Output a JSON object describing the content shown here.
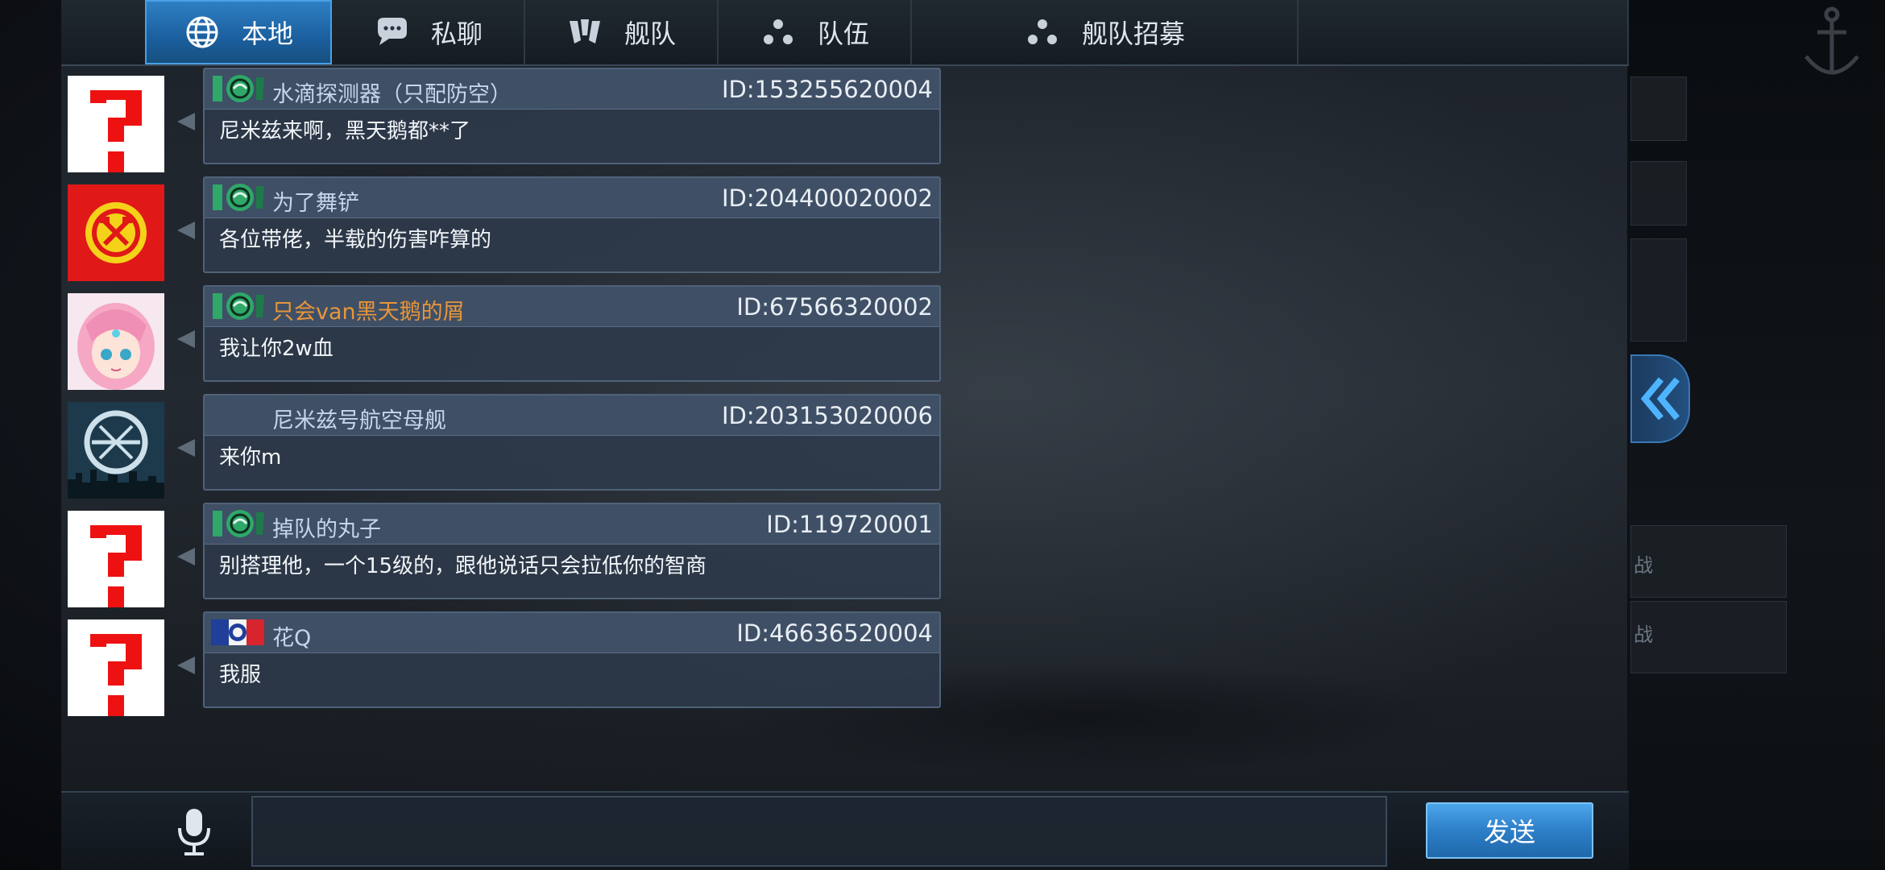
{
  "tabs": [
    {
      "label": "本地",
      "icon": "globe-icon",
      "active": true
    },
    {
      "label": "私聊",
      "icon": "chat-bubble-icon",
      "active": false
    },
    {
      "label": "舰队",
      "icon": "fleet-emblem-icon",
      "active": false
    },
    {
      "label": "队伍",
      "icon": "team-dots-icon",
      "active": false
    },
    {
      "label": "舰队招募",
      "icon": "team-dots-icon",
      "active": false
    }
  ],
  "messages": [
    {
      "sender": "水滴探测器（只配防空）",
      "user_id": "ID:153255620004",
      "text": "尼米兹来啊，黑天鹅都**了",
      "avatar": "placeholder-question",
      "badge": "green-swirl",
      "highlight": false
    },
    {
      "sender": "为了舞铲",
      "user_id": "ID:204400020002",
      "text": "各位带佬，半载的伤害咋算的",
      "avatar": "red-yellow-emblem",
      "badge": "green-swirl",
      "highlight": false
    },
    {
      "sender": "只会van黑天鹅的屑",
      "user_id": "ID:67566320002",
      "text": "我让你2w血",
      "avatar": "anime-girl",
      "badge": "green-swirl",
      "highlight": true
    },
    {
      "sender": "尼米兹号航空母舰",
      "user_id": "ID:203153020006",
      "text": "来你m",
      "avatar": "dark-crosshair",
      "badge": "none",
      "highlight": false
    },
    {
      "sender": "掉队的丸子",
      "user_id": "ID:119720001",
      "text": "别搭理他，一个15级的，跟他说话只会拉低你的智商",
      "avatar": "placeholder-question",
      "badge": "green-swirl",
      "highlight": false
    },
    {
      "sender": "花Q",
      "user_id": "ID:46636520004",
      "text": "我服",
      "avatar": "placeholder-question",
      "badge": "french-flag",
      "highlight": false
    }
  ],
  "input": {
    "value": "",
    "placeholder": ""
  },
  "send_button": {
    "label": "发送"
  },
  "side_hints": {
    "battle_1": "战",
    "battle_2": "战"
  },
  "colors": {
    "accent": "#2d7fc8",
    "highlight_name": "#e8953a"
  }
}
